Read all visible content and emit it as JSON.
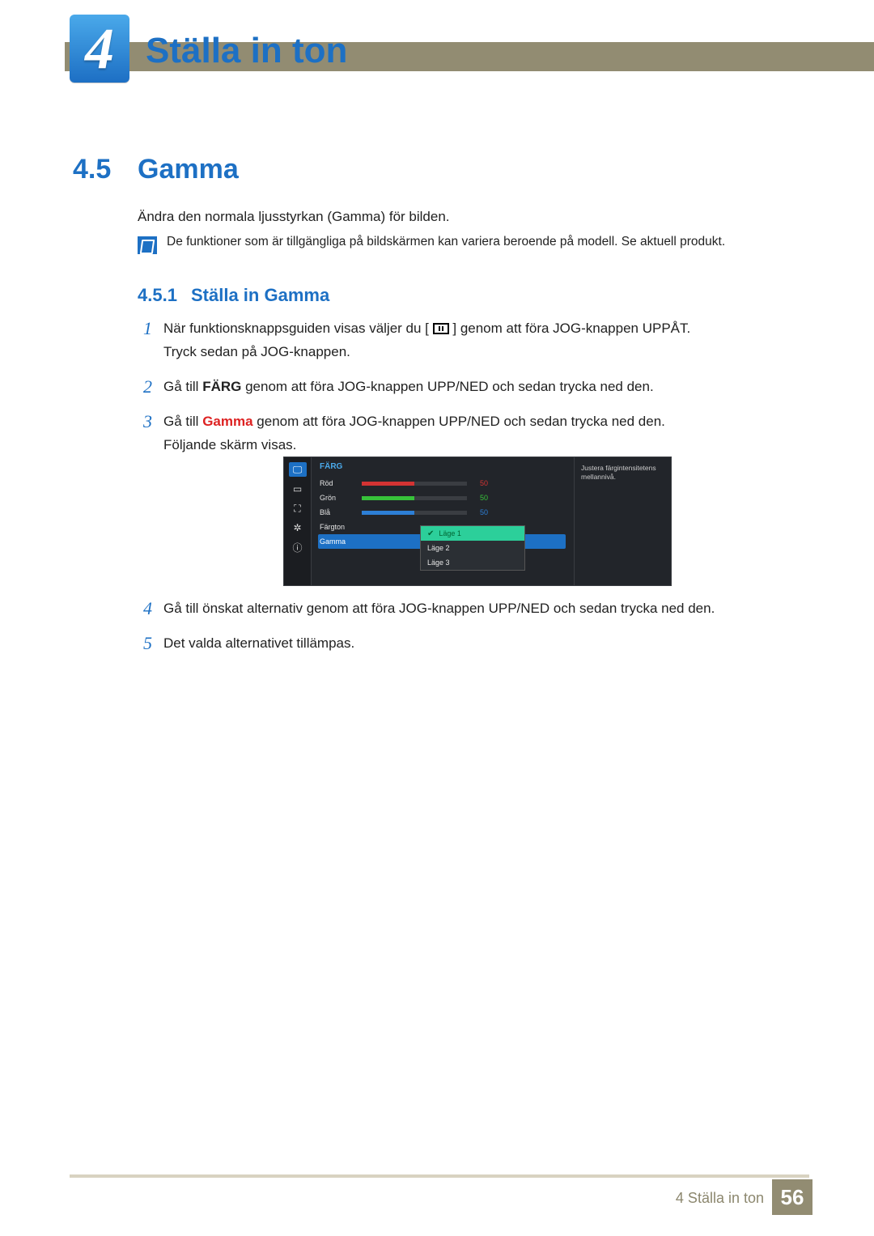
{
  "chapter": {
    "number": "4",
    "title": "Ställa in ton"
  },
  "section": {
    "number": "4.5",
    "title": "Gamma",
    "description": "Ändra den normala ljusstyrkan (Gamma) för bilden."
  },
  "note": {
    "text": "De funktioner som är tillgängliga på bildskärmen kan variera beroende på modell. Se aktuell produkt."
  },
  "subsection": {
    "number": "4.5.1",
    "title": "Ställa in Gamma"
  },
  "steps": {
    "s1a": "När funktionsknappsguiden visas väljer du [",
    "s1b": "] genom att föra JOG-knappen UPPÅT.",
    "s1c": "Tryck sedan på JOG-knappen.",
    "s2a": "Gå till ",
    "s2b": "FÄRG",
    "s2c": " genom att föra JOG-knappen UPP/NED och sedan trycka ned den.",
    "s3a": "Gå till ",
    "s3b": "Gamma",
    "s3c": " genom att föra JOG-knappen UPP/NED och sedan trycka ned den.",
    "s3d": "Följande skärm visas.",
    "s4": "Gå till önskat alternativ genom att föra JOG-knappen UPP/NED och sedan trycka ned den.",
    "s5": "Det valda alternativet tillämpas."
  },
  "osd": {
    "title": "FÄRG",
    "labels": {
      "red": "Röd",
      "green": "Grön",
      "blue": "Blå",
      "tint": "Färgton",
      "gamma": "Gamma"
    },
    "values": {
      "red": "50",
      "green": "50",
      "blue": "50"
    },
    "dropdown": {
      "opt1": "Läge 1",
      "opt2": "Läge 2",
      "opt3": "Läge 3"
    },
    "help": "Justera färgintensitetens mellannivå."
  },
  "footer": {
    "label": "4 Ställa in ton",
    "page": "56"
  }
}
